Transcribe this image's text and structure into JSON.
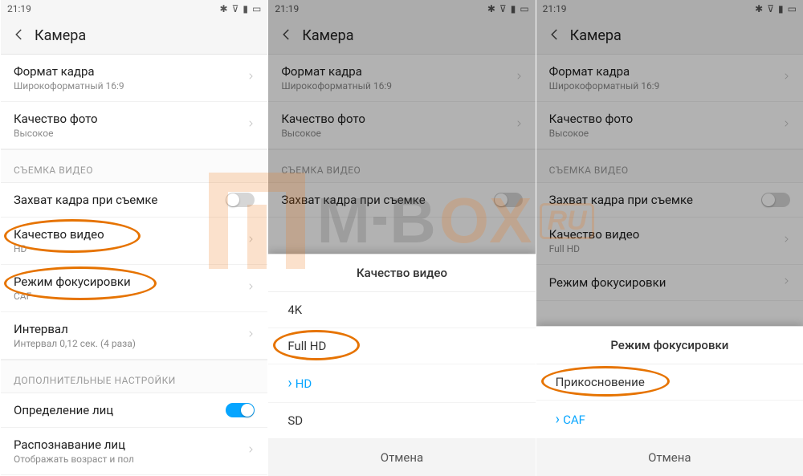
{
  "status": {
    "time": "21:19",
    "icons": [
      "bt",
      "wifi",
      "signal",
      "battery"
    ]
  },
  "header": {
    "title": "Камера"
  },
  "sections": {
    "photo": [
      {
        "key": "frame_format",
        "title": "Формат кадра",
        "sub": "Широкоформатный 16:9",
        "chevron": true
      },
      {
        "key": "photo_quality",
        "title": "Качество фото",
        "sub": "Высокое",
        "chevron": true
      }
    ],
    "video_hdr": "СЪЕМКА ВИДЕО",
    "video_p1": [
      {
        "key": "capture_frame",
        "title": "Захват кадра при съемке",
        "toggle": "off"
      },
      {
        "key": "video_quality",
        "title": "Качество видео",
        "sub": "HD",
        "chevron": true,
        "highlight": true
      },
      {
        "key": "focus_mode",
        "title": "Режим фокусировки",
        "sub": "CAF",
        "chevron": true,
        "highlight": true
      },
      {
        "key": "interval",
        "title": "Интервал",
        "sub": "Интервал 0,12 сек. (4 раза)",
        "chevron": true
      }
    ],
    "video_p3": [
      {
        "key": "capture_frame",
        "title": "Захват кадра при съемке",
        "toggle": "off"
      },
      {
        "key": "video_quality",
        "title": "Качество видео",
        "sub": "Full HD",
        "chevron": true
      },
      {
        "key": "focus_mode",
        "title": "Режим фокусировки",
        "chevron": true
      }
    ],
    "extra_hdr": "ДОПОЛНИТЕЛЬНЫЕ НАСТРОЙКИ",
    "extra": [
      {
        "key": "face_detect",
        "title": "Определение лиц",
        "toggle": "on"
      },
      {
        "key": "face_recognize",
        "title": "Распознавание лиц",
        "sub": "Отображать возраст и пол",
        "chevron": true
      }
    ]
  },
  "dialog_quality": {
    "title": "Качество видео",
    "options": [
      {
        "label": "4K",
        "selected": false
      },
      {
        "label": "Full HD",
        "selected": false,
        "highlight": true
      },
      {
        "label": "HD",
        "selected": true
      },
      {
        "label": "SD",
        "selected": false
      }
    ],
    "cancel": "Отмена"
  },
  "dialog_focus": {
    "title": "Режим фокусировки",
    "options": [
      {
        "label": "Прикосновение",
        "selected": false,
        "highlight": true
      },
      {
        "label": "CAF",
        "selected": true
      }
    ],
    "cancel": "Отмена"
  },
  "watermark": {
    "brand": "MI-BOX",
    "tld": "RU"
  }
}
